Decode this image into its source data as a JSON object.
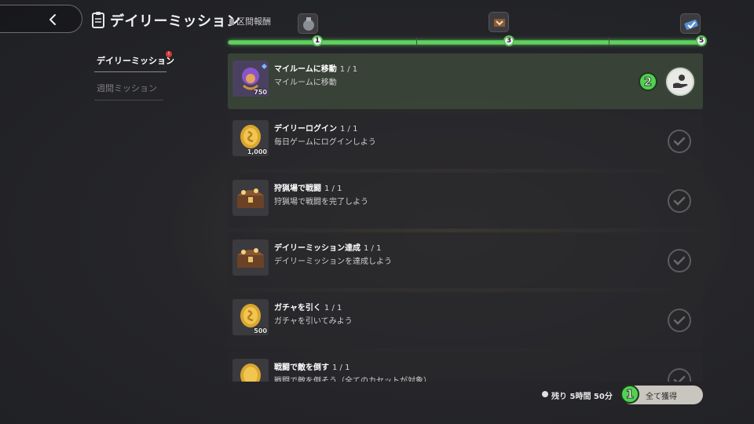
{
  "header": {
    "title": "デイリーミッション",
    "section_reward_label": "区間報酬",
    "progress": {
      "current": 5,
      "max": 5,
      "milestones": [
        "1",
        "3",
        "5"
      ]
    }
  },
  "sidebar": {
    "items": [
      {
        "label": "デイリーミッション",
        "active": true,
        "badge": "!"
      },
      {
        "label": "週間ミッション",
        "active": false
      }
    ]
  },
  "missions": [
    {
      "title": "マイルームに移動",
      "count": "1 / 1",
      "description": "マイルームに移動",
      "reward_qty": "750",
      "reward_icon": "character-icon",
      "state": "claimable"
    },
    {
      "title": "デイリーログイン",
      "count": "1 / 1",
      "description": "毎日ゲームにログインしよう",
      "reward_qty": "1,000",
      "reward_icon": "gold-coin-icon",
      "state": "done"
    },
    {
      "title": "狩猟場で戦闘",
      "count": "1 / 1",
      "description": "狩猟場で戦闘を完了しよう",
      "reward_qty": "",
      "reward_icon": "treasure-chest-icon",
      "state": "done"
    },
    {
      "title": "デイリーミッション達成",
      "count": "1 / 1",
      "description": "デイリーミッションを達成しよう",
      "reward_qty": "",
      "reward_icon": "treasure-chest-icon",
      "state": "done"
    },
    {
      "title": "ガチャを引く",
      "count": "1 / 1",
      "description": "ガチャを引いてみよう",
      "reward_qty": "500",
      "reward_icon": "gold-coin-icon",
      "state": "done"
    },
    {
      "title": "戦闘で敵を倒す",
      "count": "1 / 1",
      "description": "戦闘で敵を倒そう（全てのカセットが対象）",
      "reward_qty": "",
      "reward_icon": "gold-coin-icon",
      "state": "done"
    }
  ],
  "annotations": [
    "1",
    "2"
  ],
  "footer": {
    "remaining_label": "残り",
    "remaining_time": "5時間 50分",
    "claim_all_label": "全て獲得"
  },
  "colors": {
    "progress": "#5fd15f",
    "annotation": "#54d154",
    "badge": "#d43838"
  }
}
